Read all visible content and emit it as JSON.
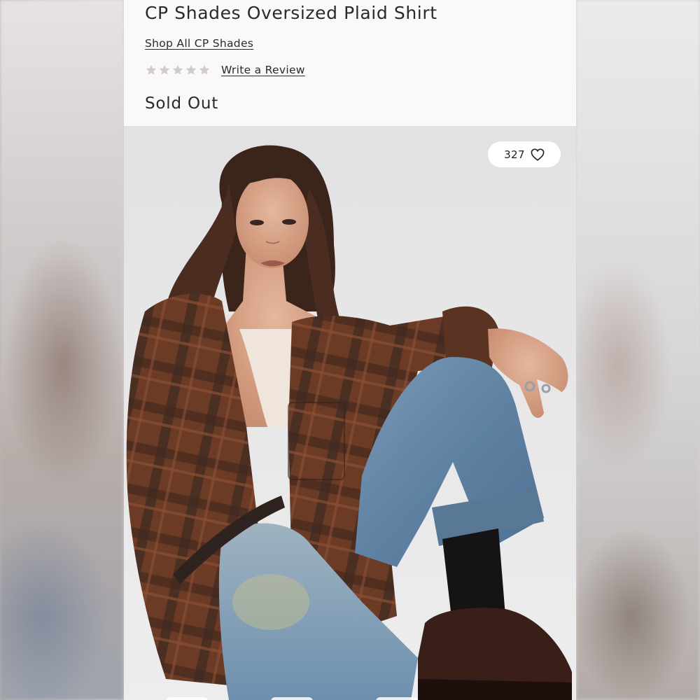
{
  "product": {
    "title": "CP Shades Oversized Plaid Shirt",
    "shop_link": "Shop All CP Shades",
    "rating_stars": 0,
    "rating_max": 5,
    "review_link": "Write a Review",
    "availability": "Sold Out"
  },
  "gallery": {
    "like_count": "327",
    "like_icon": "heart-icon"
  },
  "colors": {
    "text": "#2a2a2a",
    "star_empty": "#cfcccb",
    "panel_bg": "#faf9f8"
  }
}
